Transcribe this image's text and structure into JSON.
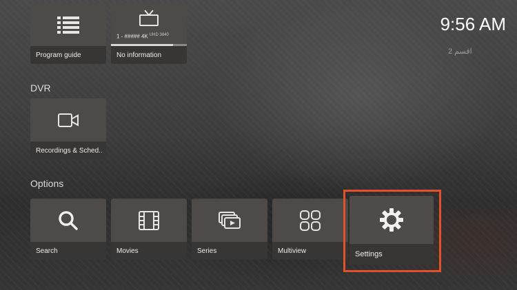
{
  "status": {
    "time": "9:56 AM"
  },
  "channel_watermark": "اقسم 2",
  "top_row": [
    {
      "label": "Program guide",
      "icon": "list-icon"
    },
    {
      "label": "No information",
      "icon": "tv-icon",
      "channel": "1 - ##### 4K",
      "channel_badge": "UHD 3840",
      "progress": 0.82
    }
  ],
  "dvr": {
    "title": "DVR",
    "items": [
      {
        "label": "Recordings & Sched..",
        "icon": "video-camera-icon"
      }
    ]
  },
  "options": {
    "title": "Options",
    "items": [
      {
        "label": "Search",
        "icon": "search-icon"
      },
      {
        "label": "Movies",
        "icon": "film-icon"
      },
      {
        "label": "Series",
        "icon": "series-icon"
      },
      {
        "label": "Multiview",
        "icon": "grid-icon"
      },
      {
        "label": "Settings",
        "icon": "gear-icon",
        "selected": true
      }
    ]
  },
  "colors": {
    "focus": "#e1522b",
    "tile": "#4d4a48",
    "tile_label": "#383634"
  }
}
